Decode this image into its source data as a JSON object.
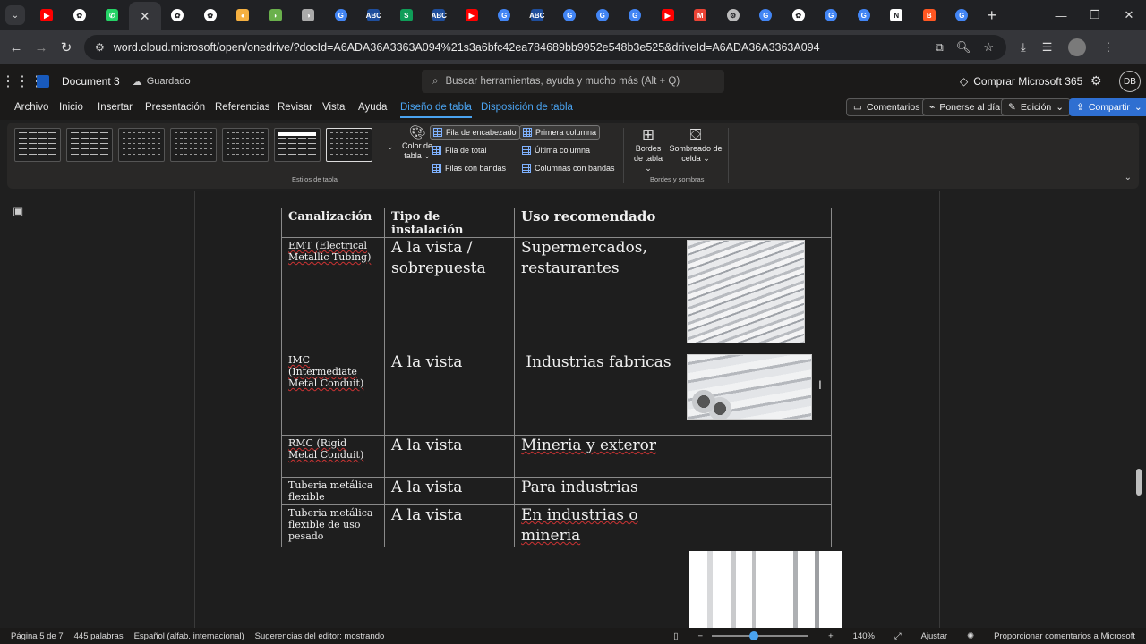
{
  "browser": {
    "tab_favicons": [
      {
        "name": "youtube",
        "color": "#ff0000",
        "glyph": "▶"
      },
      {
        "name": "chatgpt",
        "color": "#ffffff",
        "glyph": "✿"
      },
      {
        "name": "whatsapp",
        "color": "#25d366",
        "glyph": "✆"
      },
      {
        "name": "active-tab",
        "color": "",
        "glyph": ""
      },
      {
        "name": "chatgpt",
        "color": "#ffffff",
        "glyph": "✿"
      },
      {
        "name": "chatgpt",
        "color": "#ffffff",
        "glyph": "✿"
      },
      {
        "name": "orange-app",
        "color": "#f5b041",
        "glyph": "●"
      },
      {
        "name": "green-app",
        "color": "#6ab04c",
        "glyph": "◗"
      },
      {
        "name": "gray-app",
        "color": "#aaaaaa",
        "glyph": "◑"
      },
      {
        "name": "google",
        "color": "#4285f4",
        "glyph": "G"
      },
      {
        "name": "abc-news",
        "color": "#1f4e9c",
        "glyph": "ABC"
      },
      {
        "name": "sheets",
        "color": "#0f9d58",
        "glyph": "S"
      },
      {
        "name": "abc-news",
        "color": "#1f4e9c",
        "glyph": "ABC"
      },
      {
        "name": "youtube",
        "color": "#ff0000",
        "glyph": "▶"
      },
      {
        "name": "google",
        "color": "#4285f4",
        "glyph": "G"
      },
      {
        "name": "abc-news",
        "color": "#1f4e9c",
        "glyph": "ABC"
      },
      {
        "name": "google",
        "color": "#4285f4",
        "glyph": "G"
      },
      {
        "name": "google",
        "color": "#4285f4",
        "glyph": "G"
      },
      {
        "name": "google",
        "color": "#4285f4",
        "glyph": "G"
      },
      {
        "name": "youtube",
        "color": "#ff0000",
        "glyph": "▶"
      },
      {
        "name": "gmail",
        "color": "#ea4335",
        "glyph": "M"
      },
      {
        "name": "settings",
        "color": "#bbbbbb",
        "glyph": "⚙"
      },
      {
        "name": "google",
        "color": "#4285f4",
        "glyph": "G"
      },
      {
        "name": "chatgpt",
        "color": "#ffffff",
        "glyph": "✿"
      },
      {
        "name": "google",
        "color": "#4285f4",
        "glyph": "G"
      },
      {
        "name": "google",
        "color": "#4285f4",
        "glyph": "G"
      },
      {
        "name": "notion",
        "color": "#ffffff",
        "glyph": "N"
      },
      {
        "name": "blogger",
        "color": "#ff5722",
        "glyph": "B"
      },
      {
        "name": "google",
        "color": "#4285f4",
        "glyph": "G"
      }
    ],
    "url": "word.cloud.microsoft/open/onedrive/?docId=A6ADA36A3363A094%21s3a6bfc42ea784689bb9952e548b3e525&driveId=A6ADA36A3363A094"
  },
  "office": {
    "doc_name": "Document 3",
    "saved_status": "Guardado",
    "search_placeholder": "Buscar herramientas, ayuda y mucho más (Alt + Q)",
    "buy_label": "Comprar Microsoft 365",
    "avatar_initials": "DB"
  },
  "ribbon_tabs": [
    {
      "label": "Archivo",
      "style": "normal"
    },
    {
      "label": "Inicio",
      "style": "normal"
    },
    {
      "label": "Insertar",
      "style": "normal"
    },
    {
      "label": "Presentación",
      "style": "normal"
    },
    {
      "label": "Referencias",
      "style": "normal"
    },
    {
      "label": "Revisar",
      "style": "normal"
    },
    {
      "label": "Vista",
      "style": "normal"
    },
    {
      "label": "Ayuda",
      "style": "normal"
    },
    {
      "label": "Diseño de tabla",
      "style": "selected"
    },
    {
      "label": "Disposición de tabla",
      "style": "blue"
    }
  ],
  "ribbon_actions": {
    "comments": "Comentarios",
    "catch_up": "Ponerse al día",
    "editing": "Edición",
    "share": "Compartir"
  },
  "ribbon": {
    "styles_group_label": "Estilos de tabla",
    "table_color": "Color de tabla",
    "options": {
      "header_row": "Fila de encabezado",
      "total_row": "Fila de total",
      "banded_rows": "Filas con bandas",
      "first_column": "Primera columna",
      "last_column": "Última columna",
      "banded_columns": "Columnas con bandas"
    },
    "borders": "Bordes de tabla",
    "shading": "Sombreado de celda",
    "borders_group_label": "Bordes y sombras"
  },
  "table": {
    "headers": [
      "Canalización",
      "Tipo de instalación",
      "Uso recomendado",
      ""
    ],
    "rows": [
      {
        "canalizacion": "EMT (Electrical Metallic Tubing)",
        "tipo": "A la vista / sobrepuesta",
        "uso": "Supermercados, restaurantes",
        "image": "steel-pipes-photo"
      },
      {
        "canalizacion": "IMC (Intermediate Metal Conduit)",
        "tipo": "A la vista",
        "uso": " Industrias fabricas",
        "image": "imc-conduit-photo"
      },
      {
        "canalizacion": "RMC (Rigid Metal Conduit)",
        "tipo": "A la vista",
        "uso": "Mineria y exteror",
        "image": ""
      },
      {
        "canalizacion": "Tuberia metálica flexible",
        "tipo": "A la vista",
        "uso": "Para industrias",
        "image": ""
      },
      {
        "canalizacion": "Tuberia metálica flexible de uso pesado",
        "tipo": "A la vista",
        "uso": "En industrias o mineria",
        "image": ""
      }
    ]
  },
  "status": {
    "page": "Página 5 de 7",
    "words": "445 palabras",
    "language": "Español (alfab. internacional)",
    "suggestions": "Sugerencias del editor: mostrando",
    "zoom": "140%",
    "fit": "Ajustar",
    "feedback": "Proporcionar comentarios a Microsoft"
  }
}
